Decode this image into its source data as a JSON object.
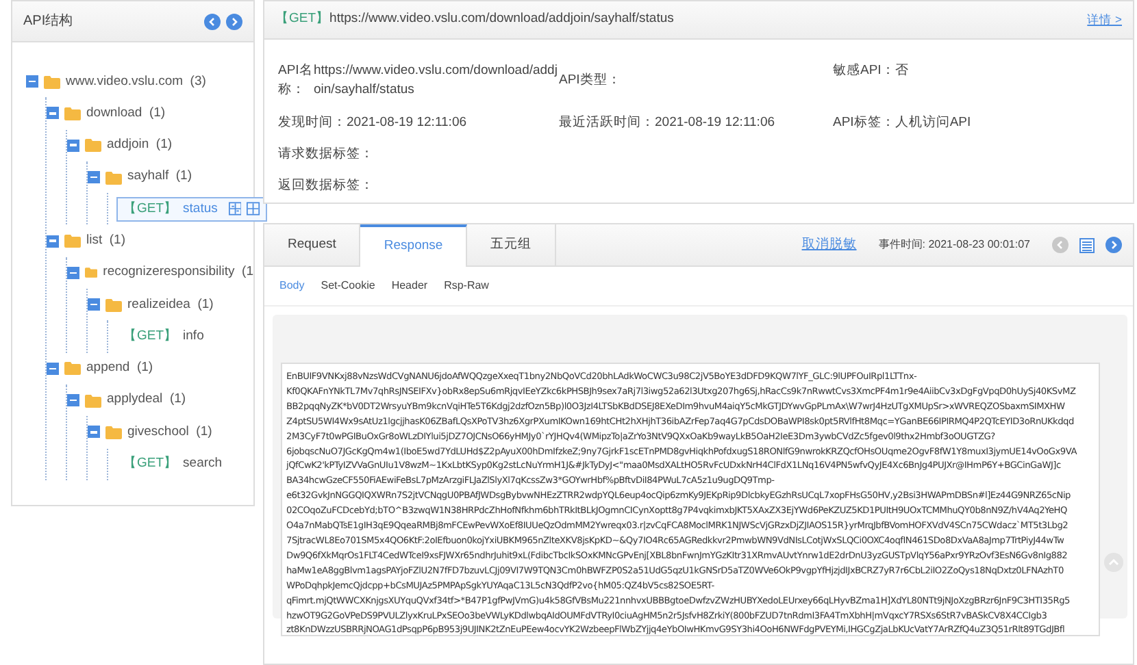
{
  "sidebar": {
    "title": "API结构",
    "prev_disabled": false,
    "next_disabled": false,
    "tree": [
      {
        "kind": "folder",
        "label": "www.video.vslu.com",
        "count": "(3)",
        "expanded": true,
        "selected": false,
        "children": [
          {
            "kind": "folder",
            "label": "download",
            "count": "(1)",
            "expanded": true,
            "selected": false,
            "children": [
              {
                "kind": "folder",
                "label": "addjoin",
                "count": "(1)",
                "expanded": true,
                "selected": false,
                "children": [
                  {
                    "kind": "folder",
                    "label": "sayhalf",
                    "count": "(1)",
                    "expanded": true,
                    "selected": false,
                    "children": [
                      {
                        "kind": "endpoint",
                        "method": "【GET】",
                        "label": "status",
                        "selected": true
                      }
                    ]
                  }
                ]
              }
            ]
          },
          {
            "kind": "folder",
            "label": "list",
            "count": "(1)",
            "expanded": true,
            "selected": false,
            "children": [
              {
                "kind": "folder",
                "label": "recognizeresponsibility",
                "count": "(1",
                "expanded": true,
                "selected": false,
                "children": [
                  {
                    "kind": "folder",
                    "label": "realizeidea",
                    "count": "(1)",
                    "expanded": true,
                    "selected": false,
                    "children": [
                      {
                        "kind": "endpoint",
                        "method": "【GET】",
                        "label": "info",
                        "selected": false
                      }
                    ]
                  }
                ]
              }
            ]
          },
          {
            "kind": "folder",
            "label": "append",
            "count": "(1)",
            "expanded": true,
            "selected": false,
            "children": [
              {
                "kind": "folder",
                "label": "applydeal",
                "count": "(1)",
                "expanded": true,
                "selected": false,
                "children": [
                  {
                    "kind": "folder",
                    "label": "giveschool",
                    "count": "(1)",
                    "expanded": true,
                    "selected": false,
                    "children": [
                      {
                        "kind": "endpoint",
                        "method": "【GET】",
                        "label": "search",
                        "selected": false
                      }
                    ]
                  }
                ]
              }
            ]
          }
        ]
      }
    ]
  },
  "api": {
    "method": "【GET】",
    "url": "https://www.video.vslu.com/download/addjoin/sayhalf/status",
    "detail_link": "详情 >",
    "fields": [
      {
        "label": "API名称：",
        "value": "https://www.video.vslu.com/download/addjoin/sayhalf/status"
      },
      {
        "label": "API类型："
      },
      {
        "label": "敏感API：",
        "value": "否"
      },
      {
        "label": "发现时间：",
        "value": "2021-08-19 12:11:06"
      },
      {
        "label": "最近活跃时间：",
        "value": "2021-08-19 12:11:06"
      },
      {
        "label": "API标签：",
        "value": "人机访问API"
      },
      {
        "label": "请求数据标签："
      },
      {
        "label": "返回数据标签："
      }
    ]
  },
  "event": {
    "tabs": [
      {
        "label": "Request",
        "selected": false
      },
      {
        "label": "Response",
        "selected": true
      },
      {
        "label": "五元组",
        "selected": false
      }
    ],
    "desensitize_link": "取消脱敏",
    "event_time": "事件时间: 2021-08-23 00:01:07",
    "prev_disabled": true,
    "next_disabled": false,
    "subtabs": [
      {
        "label": "Body",
        "selected": true
      },
      {
        "label": "Set-Cookie",
        "selected": false
      },
      {
        "label": "Header",
        "selected": false
      },
      {
        "label": "Rsp-Raw",
        "selected": false
      }
    ],
    "body_lines": [
      "EnBUIF9VNKxj88vNzsWdCVgNANU6jdoAfWQQzgeXxeqT1bny2NbQoVCd20bhLAdkWoCWC3u98C2jV5BoYE3dDFD9KQW7lYF_GLC:9lUPFOuIRpl1LTTnx-",
      "Kf0QKAFnYNkTL7Mv7qhRsJNSEIFXv}obRx8epSu6mRjqvIEeYZkc6kPHSBJh9sex7aRj7l3iwg52a62l3Utxg207hg6Sj,hRacCs9k7nRwwtCvs3XmcPF4m1r9e4AiibCv3xDgFgVpqD0hUySj40KSvMZ",
      "BB2pqqNyZK*bV0DT2WrsyuYBm9kcnVqiHTe5T6Kdgj2dzfOzn5Bp)l0O3JzI4LTSbKBdDSEJ8EXeDIm9hvuM4aiqY5cMkGTJDYwvGpPLmAx\\W7wrJ4HzUTgXMUpSr>xWVREQZOSbaxmSIMXHW",
      "Z4ptSU5WI4Wx9sAtUz1lgcjjhasK06ZBafLQsXPoTV3hz6XgrPXumIKOwn169htCHt2hXHjhT36ibAZrFep7aq4G7pCdsDOBaWPI8sk0pt5RVlfHt8Mqc=YGanBE66IPIRMQ4P2QTcEYID3oRnUKkdqd",
      "2M3CyF7t0wPGIBuOxGr8oWLzDIYlui5jDZ7OJCNsO66yHMJy0`rYJHQv4(WMipzTo|aZrYo3NtV9QXxOaKb9wayLkB5OaH2IeE3Dm3ywbCVdZc5fgev0l9thx2Hmbf3oOUGTZG?",
      "6jobqscNuO7JGcKgQm4w1(IboE5wd7YdLUHd$Z2pAyuX00hDmIfzkeZ;9ny7GjrkF1scETnPMD8gvHiqkhPofdxugS18RONlfG9nwrokKRZQcfOHsOUqme2OgvF8fW1Y8muxI3jymUE14vOoGx9VA",
      "jQfCwK2'kPTyIZVVaGnUIu1V8wzM~1KxLbtKSyp0Kg2stLcNuYrmH1J&#JkTyDyJ<\"maa0MsdXALtHO5RvFcUDxkNrH4ClFdX1LNq16V4PN5wfvQyJE4Xc6BnJg4PUJXr@IHmP6Y+BGCinGaWJ]c",
      "BA34hcwGzeCF550FiAEwiFeBsL7pMzArzgiFLJaZlSlyXl7qKcssZw3*GOYwrHbf%pBftvDiI84PWuL7cA5z1u9ugDQ9Tmp-",
      "e6t32GvkJnNGGQIQXWRn7S2jtVCNqgU0PBAfJWDsgBybvwNHEzZTRR2wdpYQL6eup4ocQip6zmKy9JEKpRip9DlcbkyEGzhRsUCqL7xopFHsG50HV,y2Bsi3HWAPmDBSn#l]Ez44G9NRZ65cNip",
      "02COqoZuFCDcebYd;bTO^B3zwqW1N38HRPdcZhHofNfkhm6bhTRkItBLkJOgmnCICynXoptt8g7P4vqkimxbJKT5XAxZX3EjYWd6PeKZUZ5KD1PUItH9UOxTCMMhuQY0b8nN9Z/hV4Aq2YeHQ",
      "O4a7nMabQTsE1gIH3qE9QqeaRMBj8mFCEwPevWXoEf8IUUeQzOdmMM2Ywreqx03.r|zvCqFCA8MoclMRK1NJWScVjGRzxDjZJIAOS15R}yrMrqJbfBVomHOFXVdV4SCn75CWdacz`MT5t3Lbg2",
      "7SjtracWL8Eo701SM5x4QO6KtF:2oIEfbuon0kojYxiUBKM965nZlteXKV8jsKpKD~&Qy7IO4Rc65AGRedkkvr2PmwbWN9VdNIsLCotjWxSLQCi0OXC4oqfIN461SDo8DxVaA8aJmp7TrtPiyJ44wTw",
      "Dw9Q6fXkMqrOs1FLT4CedWTceI9xsFJWXr65ndhrJuhit9xL(FdibcTbcIkSOxKMNcGPvEnj[XBL8bnFwnJmYGzKItr31XRmvAUvtYnrw1dE2drDnU3yzGUSTpVlqY56aPxr9YRzOvf3EsN6Gv8nIg882",
      "haMw1eA8ggBlvm1agsPAYjoFZlU2N7fFD7bzuvLCJj09VI7W9TQN3Cm0hBWFZP0S2a51UdG5qzU1kGNSrD5aTZ0WVe6OkP9vgpYfHjzjdIJxBCRZ7yR7r6CbL2iIO2ZoQys18NqDxtz0LFNAzhT0",
      "WPoDqhpkJemcQjdcpp+bCsMUJAz5PMPApSgkYUYAqaC13L5cN3QdfP2vo{hM05:QZ4bV5cs82SOE5RT-",
      "qFimrt.mjQtWWCXKnjgsXUYquQVxf34tf>*B47P1gfPwJVmG)u4k58GfVBsMu221nnhvxUBBBgtoeDwfzvZWzHUBYXedoLEUrxey66qLHyvBZma1H]XdYL80NTt9jNJoXzgBRzr6JnF9C3HTI35Rg5",
      "hzwOT9G2GoVPeDS9PVULZlyxKruLPxSEOo3beVWLyKDdlwbqAIdOUMFdVTRyI0ciuAgHM5n2r5JsfvH8ZrkiY(800bFZUD7tnRdmI3FA4TmXbhH|mVqxcY7RSXs6StR7vBASkCV8X4CCIgb3",
      "zt8KnDWzzUSBRRjNOAG1dPsqpP6pB953j9UJINK2tZnEuPEew4ocvYK2WzbeepFlWbZYjjq4eYbOIwHKmvG9SY3hi4OoH6NWFdgPVEYMi,IHGCgZjaLbKUcVatY7ArRZfQ4uZ3Q51rRlt89TGdJBfl"
    ]
  }
}
